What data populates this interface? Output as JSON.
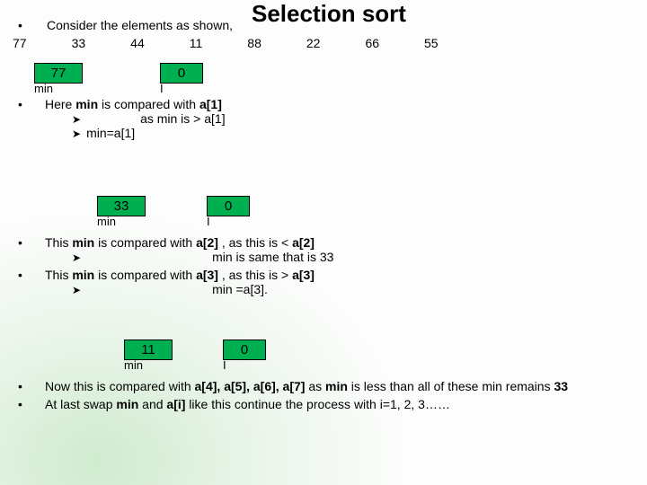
{
  "title": "Selection sort",
  "intro": "Consider the elements as shown,",
  "array": [
    "77",
    "33",
    "44",
    "11",
    "88",
    "22",
    "66",
    "55"
  ],
  "step1": {
    "minVal": "77",
    "iVal": "0",
    "minLabel": "min",
    "iLabel": "I",
    "line": "Here min is compared with a[1]",
    "sub1": "as min is > a[1]",
    "sub2": "min=a[1]"
  },
  "step2": {
    "minVal": "33",
    "iVal": "0",
    "minLabel": "min",
    "iLabel": "I",
    "line1": "This min is compared with a[2] , as this is < a[2]",
    "sub1": "min is same that is 33",
    "line2": "This min is compared with a[3] , as this is > a[3]",
    "sub2": "min =a[3]."
  },
  "step3": {
    "minVal": "11",
    "iVal": "0",
    "minLabel": "min",
    "iLabel": "I",
    "line1": "Now this is compared with a[4], a[5], a[6], a[7] as min is less than all of these min remains 33",
    "line2": "At last swap min  and a[i] like this continue the process with i=1, 2, 3……"
  }
}
